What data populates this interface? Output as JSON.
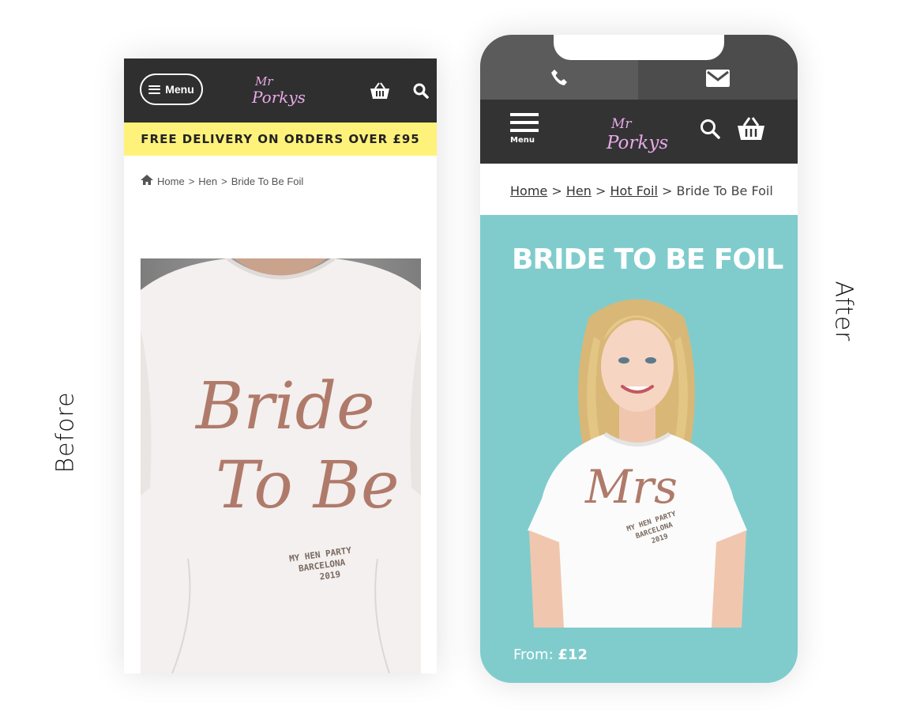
{
  "labels": {
    "before": "Before",
    "after": "After"
  },
  "before": {
    "header": {
      "menu_label": "Menu",
      "logo_top": "Mr",
      "logo_bottom": "Porkys"
    },
    "promo_text": "FREE DELIVERY ON ORDERS OVER £95",
    "breadcrumb": [
      "Home",
      "Hen",
      "Bride To Be Foil"
    ],
    "shirt": {
      "line1": "Bride",
      "line2": "To Be",
      "sub1": "MY HEN PARTY",
      "sub2": "BARCELONA",
      "sub3": "2019"
    }
  },
  "after": {
    "header": {
      "menu_label": "Menu",
      "logo_top": "Mr",
      "logo_bottom": "Porkys"
    },
    "breadcrumb": [
      "Home",
      "Hen",
      "Hot Foil",
      "Bride To Be Foil"
    ],
    "title": "BRIDE TO BE FOIL",
    "shirt": {
      "line1": "Mrs",
      "sub1": "MY HEN PARTY",
      "sub2": "BARCELONA",
      "sub3": "2019"
    },
    "price_prefix": "From:",
    "price_value": "£12"
  },
  "colors": {
    "header_bg": "#333333",
    "promo_bg": "#fff27a",
    "accent_teal": "#80cccd",
    "logo_pink": "#e8a9e8",
    "foil": "#b07a6a"
  }
}
